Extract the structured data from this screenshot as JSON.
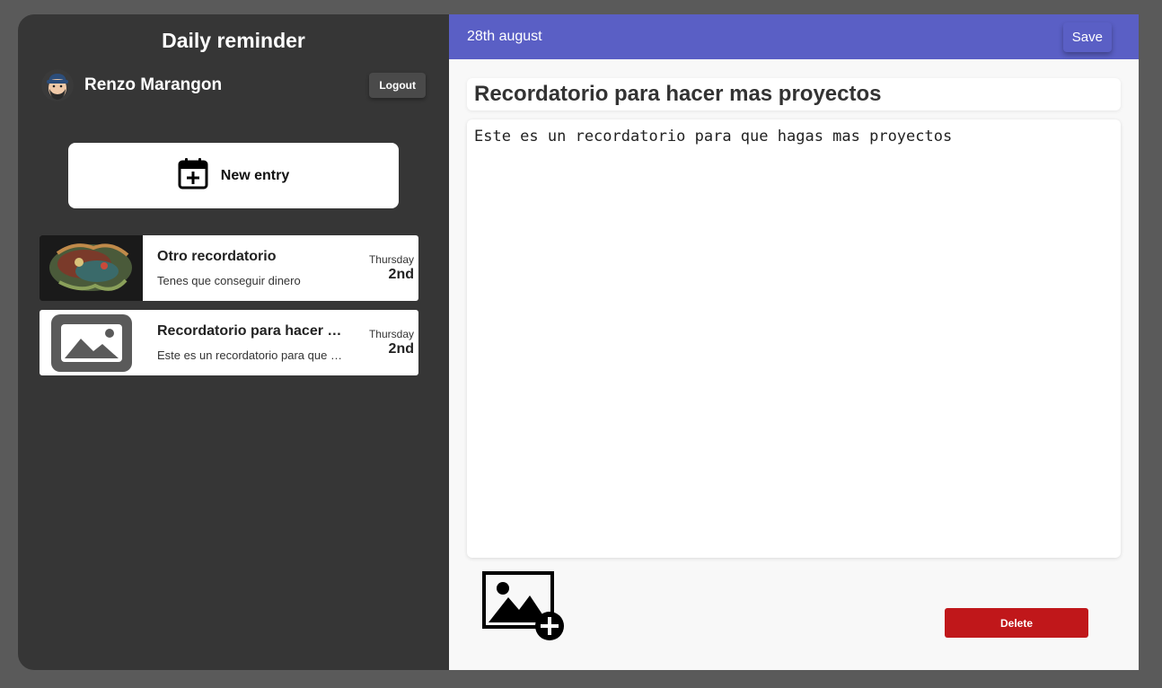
{
  "sidebar": {
    "app_title": "Daily reminder",
    "user": {
      "name": "Renzo Marangon"
    },
    "logout_label": "Logout",
    "new_entry_label": "New entry",
    "entries": [
      {
        "title": "Otro recordatorio",
        "description": "Tenes que conseguir dinero",
        "day": "Thursday",
        "date": "2nd",
        "thumbnail": "artwork-image"
      },
      {
        "title": "Recordatorio para hacer mas proyectos",
        "description": "Este es un recordatorio para que hagas mas proyectos",
        "day": "Thursday",
        "date": "2nd",
        "thumbnail": "image-placeholder-icon"
      }
    ]
  },
  "main": {
    "date": "28th august",
    "save_label": "Save",
    "note_title": "Recordatorio para hacer mas proyectos",
    "note_body": "Este es un recordatorio para que hagas mas proyectos",
    "delete_label": "Delete"
  },
  "colors": {
    "background": "#5a5a5a",
    "sidebar": "#363636",
    "topbar": "#5a5fc5",
    "delete": "#c0171a",
    "main": "#f8f8f8"
  }
}
